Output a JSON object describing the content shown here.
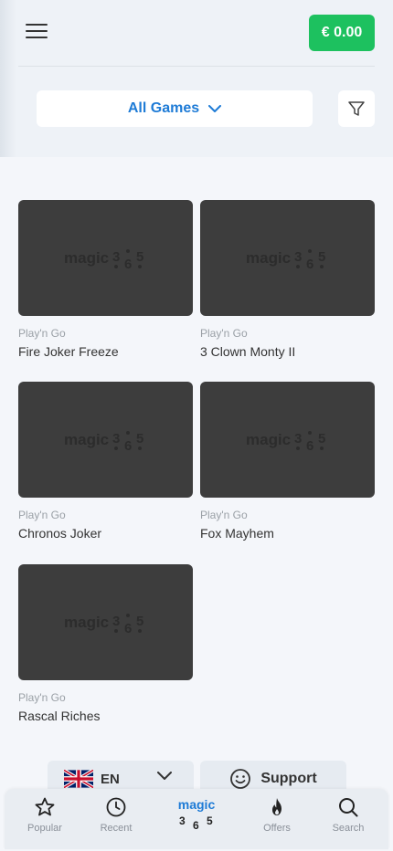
{
  "header": {
    "balance": "€ 0.00",
    "category": "All Games"
  },
  "brand": {
    "logo_text": "magic",
    "logo_digits": [
      "3",
      "6",
      "5"
    ]
  },
  "games": [
    {
      "provider": "Play'n Go",
      "title": "Fire Joker Freeze"
    },
    {
      "provider": "Play'n Go",
      "title": "3 Clown Monty II"
    },
    {
      "provider": "Play'n Go",
      "title": "Chronos Joker"
    },
    {
      "provider": "Play'n Go",
      "title": "Fox Mayhem"
    },
    {
      "provider": "Play'n Go",
      "title": "Rascal Riches"
    }
  ],
  "footer": {
    "language": "EN",
    "support_label": "Support"
  },
  "nav": {
    "popular": "Popular",
    "recent": "Recent",
    "offers": "Offers",
    "search": "Search"
  },
  "colors": {
    "accent": "#1e7bd6",
    "balance_bg": "#1dc15f",
    "thumb_bg": "#3d3d3d"
  }
}
